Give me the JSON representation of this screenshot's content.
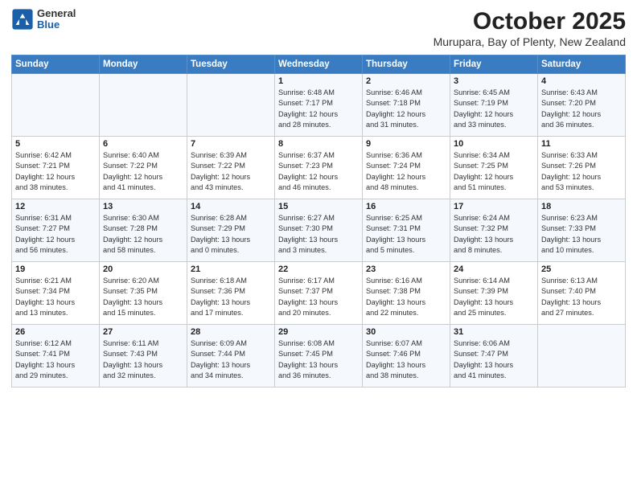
{
  "logo": {
    "general": "General",
    "blue": "Blue"
  },
  "title": "October 2025",
  "subtitle": "Murupara, Bay of Plenty, New Zealand",
  "weekdays": [
    "Sunday",
    "Monday",
    "Tuesday",
    "Wednesday",
    "Thursday",
    "Friday",
    "Saturday"
  ],
  "weeks": [
    [
      {
        "day": "",
        "info": ""
      },
      {
        "day": "",
        "info": ""
      },
      {
        "day": "",
        "info": ""
      },
      {
        "day": "1",
        "info": "Sunrise: 6:48 AM\nSunset: 7:17 PM\nDaylight: 12 hours\nand 28 minutes."
      },
      {
        "day": "2",
        "info": "Sunrise: 6:46 AM\nSunset: 7:18 PM\nDaylight: 12 hours\nand 31 minutes."
      },
      {
        "day": "3",
        "info": "Sunrise: 6:45 AM\nSunset: 7:19 PM\nDaylight: 12 hours\nand 33 minutes."
      },
      {
        "day": "4",
        "info": "Sunrise: 6:43 AM\nSunset: 7:20 PM\nDaylight: 12 hours\nand 36 minutes."
      }
    ],
    [
      {
        "day": "5",
        "info": "Sunrise: 6:42 AM\nSunset: 7:21 PM\nDaylight: 12 hours\nand 38 minutes."
      },
      {
        "day": "6",
        "info": "Sunrise: 6:40 AM\nSunset: 7:22 PM\nDaylight: 12 hours\nand 41 minutes."
      },
      {
        "day": "7",
        "info": "Sunrise: 6:39 AM\nSunset: 7:22 PM\nDaylight: 12 hours\nand 43 minutes."
      },
      {
        "day": "8",
        "info": "Sunrise: 6:37 AM\nSunset: 7:23 PM\nDaylight: 12 hours\nand 46 minutes."
      },
      {
        "day": "9",
        "info": "Sunrise: 6:36 AM\nSunset: 7:24 PM\nDaylight: 12 hours\nand 48 minutes."
      },
      {
        "day": "10",
        "info": "Sunrise: 6:34 AM\nSunset: 7:25 PM\nDaylight: 12 hours\nand 51 minutes."
      },
      {
        "day": "11",
        "info": "Sunrise: 6:33 AM\nSunset: 7:26 PM\nDaylight: 12 hours\nand 53 minutes."
      }
    ],
    [
      {
        "day": "12",
        "info": "Sunrise: 6:31 AM\nSunset: 7:27 PM\nDaylight: 12 hours\nand 56 minutes."
      },
      {
        "day": "13",
        "info": "Sunrise: 6:30 AM\nSunset: 7:28 PM\nDaylight: 12 hours\nand 58 minutes."
      },
      {
        "day": "14",
        "info": "Sunrise: 6:28 AM\nSunset: 7:29 PM\nDaylight: 13 hours\nand 0 minutes."
      },
      {
        "day": "15",
        "info": "Sunrise: 6:27 AM\nSunset: 7:30 PM\nDaylight: 13 hours\nand 3 minutes."
      },
      {
        "day": "16",
        "info": "Sunrise: 6:25 AM\nSunset: 7:31 PM\nDaylight: 13 hours\nand 5 minutes."
      },
      {
        "day": "17",
        "info": "Sunrise: 6:24 AM\nSunset: 7:32 PM\nDaylight: 13 hours\nand 8 minutes."
      },
      {
        "day": "18",
        "info": "Sunrise: 6:23 AM\nSunset: 7:33 PM\nDaylight: 13 hours\nand 10 minutes."
      }
    ],
    [
      {
        "day": "19",
        "info": "Sunrise: 6:21 AM\nSunset: 7:34 PM\nDaylight: 13 hours\nand 13 minutes."
      },
      {
        "day": "20",
        "info": "Sunrise: 6:20 AM\nSunset: 7:35 PM\nDaylight: 13 hours\nand 15 minutes."
      },
      {
        "day": "21",
        "info": "Sunrise: 6:18 AM\nSunset: 7:36 PM\nDaylight: 13 hours\nand 17 minutes."
      },
      {
        "day": "22",
        "info": "Sunrise: 6:17 AM\nSunset: 7:37 PM\nDaylight: 13 hours\nand 20 minutes."
      },
      {
        "day": "23",
        "info": "Sunrise: 6:16 AM\nSunset: 7:38 PM\nDaylight: 13 hours\nand 22 minutes."
      },
      {
        "day": "24",
        "info": "Sunrise: 6:14 AM\nSunset: 7:39 PM\nDaylight: 13 hours\nand 25 minutes."
      },
      {
        "day": "25",
        "info": "Sunrise: 6:13 AM\nSunset: 7:40 PM\nDaylight: 13 hours\nand 27 minutes."
      }
    ],
    [
      {
        "day": "26",
        "info": "Sunrise: 6:12 AM\nSunset: 7:41 PM\nDaylight: 13 hours\nand 29 minutes."
      },
      {
        "day": "27",
        "info": "Sunrise: 6:11 AM\nSunset: 7:43 PM\nDaylight: 13 hours\nand 32 minutes."
      },
      {
        "day": "28",
        "info": "Sunrise: 6:09 AM\nSunset: 7:44 PM\nDaylight: 13 hours\nand 34 minutes."
      },
      {
        "day": "29",
        "info": "Sunrise: 6:08 AM\nSunset: 7:45 PM\nDaylight: 13 hours\nand 36 minutes."
      },
      {
        "day": "30",
        "info": "Sunrise: 6:07 AM\nSunset: 7:46 PM\nDaylight: 13 hours\nand 38 minutes."
      },
      {
        "day": "31",
        "info": "Sunrise: 6:06 AM\nSunset: 7:47 PM\nDaylight: 13 hours\nand 41 minutes."
      },
      {
        "day": "",
        "info": ""
      }
    ]
  ]
}
